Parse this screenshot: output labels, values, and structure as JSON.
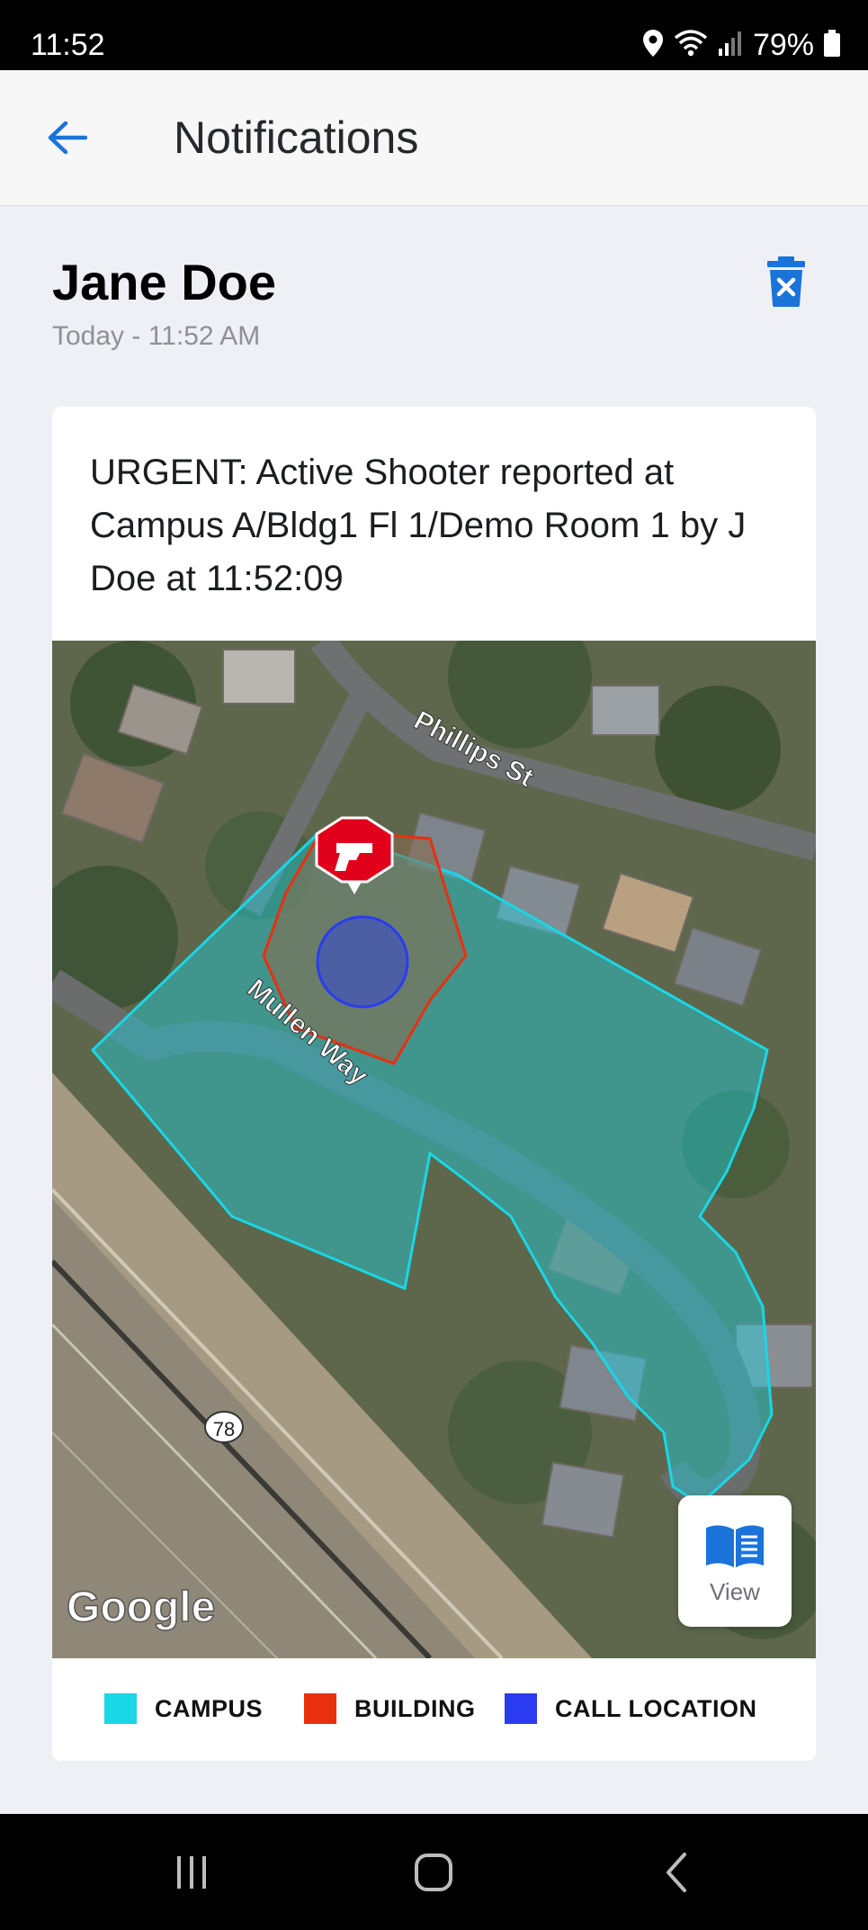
{
  "status_bar": {
    "time": "11:52",
    "battery": "79%",
    "icons": [
      "location-icon",
      "wifi-icon",
      "signal-icon",
      "battery-icon"
    ]
  },
  "app_bar": {
    "title": "Notifications",
    "back_icon": "arrow-left-icon"
  },
  "notification": {
    "sender": "Jane Doe",
    "timestamp": "Today - 11:52 AM",
    "delete_icon": "trash-x-icon",
    "message": "URGENT: Active Shooter reported at Campus A/Bldg1 Fl 1/Demo Room 1 by J Doe at 11:52:09"
  },
  "map": {
    "streets": [
      "Phillips St",
      "Mullen Way"
    ],
    "route_shield": "78",
    "provider_logo": "Google",
    "marker_icon": "gun-icon",
    "view_button": {
      "label": "View",
      "icon": "book-icon"
    }
  },
  "legend": [
    {
      "label": "CAMPUS",
      "color": "#19d7e6"
    },
    {
      "label": "BUILDING",
      "color": "#e8300f"
    },
    {
      "label": "CALL LOCATION",
      "color": "#2b3cf0"
    }
  ],
  "colors": {
    "accent": "#1a73d9",
    "marker": "#e0001b"
  },
  "nav_bar": {
    "buttons": [
      "recent-apps-icon",
      "home-icon",
      "back-icon"
    ]
  }
}
